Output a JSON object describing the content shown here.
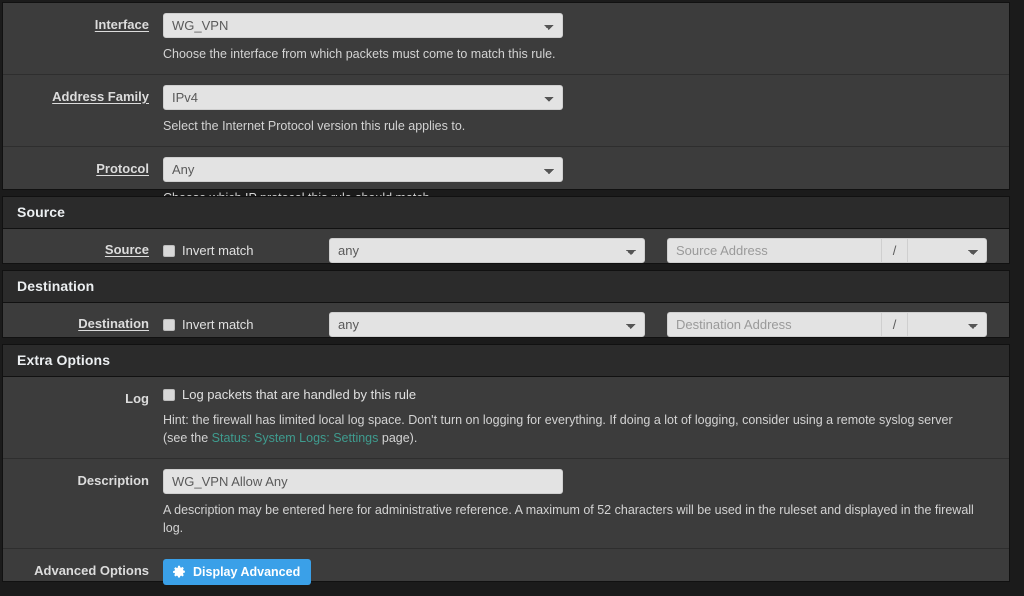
{
  "sections": {
    "top": {
      "rows": [
        {
          "label": "Interface",
          "value": "WG_VPN",
          "help": "Choose the interface from which packets must come to match this rule."
        },
        {
          "label": "Address Family",
          "value": "IPv4",
          "help": "Select the Internet Protocol version this rule applies to."
        },
        {
          "label": "Protocol",
          "value": "Any",
          "help": "Choose which IP protocol this rule should match."
        }
      ]
    },
    "source": {
      "heading": "Source",
      "label": "Source",
      "invert_label": "Invert match",
      "invert_checked": false,
      "type_value": "any",
      "address_placeholder": "Source Address",
      "separator": "/",
      "mask_value": ""
    },
    "destination": {
      "heading": "Destination",
      "label": "Destination",
      "invert_label": "Invert match",
      "invert_checked": false,
      "type_value": "any",
      "address_placeholder": "Destination Address",
      "separator": "/",
      "mask_value": ""
    },
    "extra": {
      "heading": "Extra Options",
      "log": {
        "label": "Log",
        "checkbox_label": "Log packets that are handled by this rule",
        "checked": false,
        "hint_before": "Hint: the firewall has limited local log space. Don't turn on logging for everything. If doing a lot of logging, consider using a remote syslog server (see the ",
        "hint_link": "Status: System Logs: Settings",
        "hint_after": " page)."
      },
      "description": {
        "label": "Description",
        "value": "WG_VPN Allow Any",
        "help": "A description may be entered here for administrative reference. A maximum of 52 characters will be used in the ruleset and displayed in the firewall log."
      },
      "advanced": {
        "label": "Advanced Options",
        "button_label": "Display Advanced",
        "icon": "gear-icon"
      }
    }
  },
  "colors": {
    "panel_bg": "#3c3c3c",
    "heading_bg": "#2b2b2b",
    "page_bg": "#1b1b1b",
    "control_bg": "#e3e3e3",
    "link": "#3f9c8f",
    "button_primary": "#3aa0e8"
  }
}
